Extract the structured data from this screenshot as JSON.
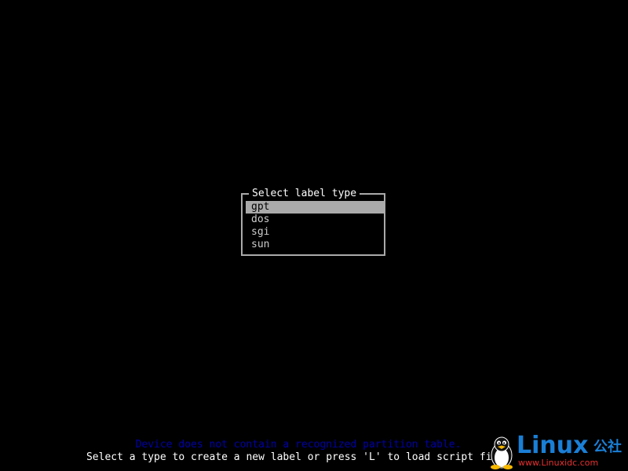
{
  "dialog": {
    "title": "Select label type",
    "selected_index": 0,
    "options": [
      "gpt",
      "dos",
      "sgi",
      "sun"
    ]
  },
  "hints": {
    "warning": "Device does not contain a recognized partition table.",
    "instruction": "Select a type to create a new label or press 'L' to load script file."
  },
  "watermark": {
    "brand": "Linux",
    "suffix": "公社",
    "url": "www.Linuxidc.com"
  },
  "colors": {
    "background": "#000000",
    "selection": "#aaaaaa",
    "warning_text": "#0000aa",
    "watermark_blue": "#1a7fd6",
    "watermark_red": "#e83030"
  }
}
